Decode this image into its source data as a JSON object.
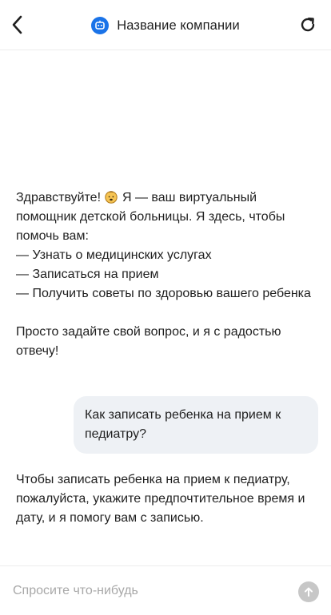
{
  "header": {
    "title": "Название компании",
    "back_icon": "chevron-left-icon",
    "refresh_icon": "refresh-icon",
    "logo_icon": "bot-logo-icon",
    "accent_color": "#1a73e8"
  },
  "messages": [
    {
      "role": "bot",
      "greeting": "Здравствуйте!",
      "emoji_icon": "baby-face-icon",
      "intro_rest": "Я — ваш виртуальный помощник детской больницы. Я здесь, чтобы помочь вам:",
      "items": [
        "— Узнать о медицинских услугах",
        "— Записаться на прием",
        "— Получить советы по здоровью вашего ребенка"
      ],
      "closing": "Просто задайте свой вопрос, и я с радостью отвечу!"
    },
    {
      "role": "user",
      "text": "Как записать ребенка на прием к педиатру?"
    },
    {
      "role": "bot",
      "text": "Чтобы записать ребенка на прием к педиатру, пожалуйста, укажите предпочтительное время и дату, и я помогу вам с записью."
    }
  ],
  "composer": {
    "placeholder": "Спросите что-нибудь",
    "value": "",
    "send_icon": "arrow-up-icon"
  }
}
